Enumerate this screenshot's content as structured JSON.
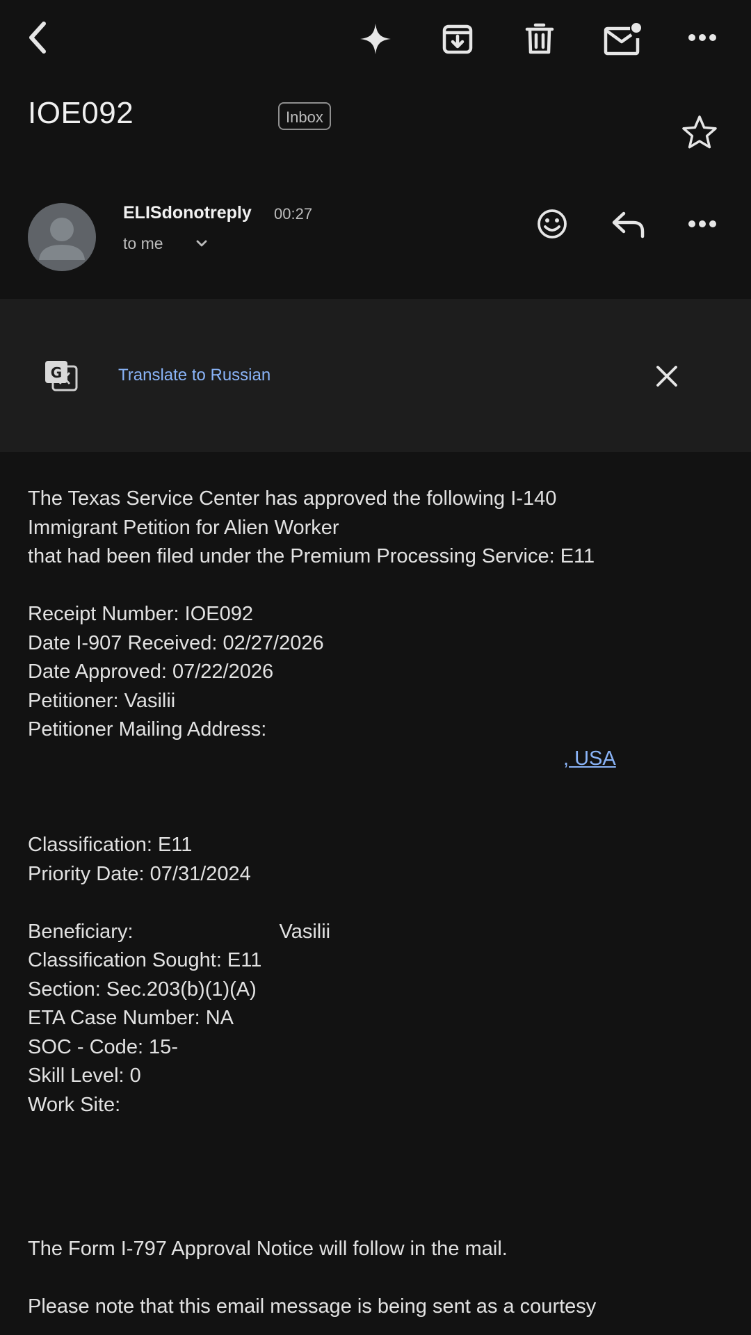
{
  "header": {
    "subject": "IOE092",
    "badge": "Inbox"
  },
  "sender": {
    "name": "ELISdonotreply",
    "time": "00:27",
    "to": "to me"
  },
  "translate": {
    "label": "Translate to Russian"
  },
  "body": {
    "intro_1": "The Texas Service Center has approved the following I-140",
    "intro_2": "Immigrant Petition for Alien Worker",
    "intro_3": "that had been filed under the Premium Processing Service: E11",
    "receipt": "Receipt Number: IOE092",
    "date_received": "Date I-907 Received: 02/27/2026",
    "date_approved": "Date Approved: 07/22/2026",
    "petitioner": "Petitioner: Vasilii",
    "mailing_label": "Petitioner Mailing Address:",
    "mailing_link": ", USA",
    "classification": "Classification: E11",
    "priority_date": "Priority Date: 07/31/2024",
    "beneficiary_label": "Beneficiary:",
    "beneficiary_name": "Vasilii",
    "classification_sought": "Classification Sought: E11",
    "section": "Section: Sec.203(b)(1)(A)",
    "eta_case": "ETA Case Number: NA",
    "soc_code": "SOC - Code: 15-",
    "skill_level": "Skill Level: 0",
    "work_site": "Work Site:",
    "i797_notice": "The Form I-797 Approval Notice will follow in the mail.",
    "courtesy": "Please note that this email message is being sent as a courtesy"
  },
  "icons": {
    "back": "back-arrow-icon",
    "sparkle": "sparkle-icon",
    "archive": "archive-icon",
    "delete": "trash-icon",
    "mark_unread": "mark-unread-icon",
    "more": "more-icon",
    "star": "star-icon",
    "emoji": "emoji-icon",
    "reply": "reply-icon",
    "translate": "translate-icon",
    "close": "close-icon"
  },
  "colors": {
    "background": "#121212",
    "link": "#8ab4f8",
    "translate_bar": "#1d1d1d"
  }
}
